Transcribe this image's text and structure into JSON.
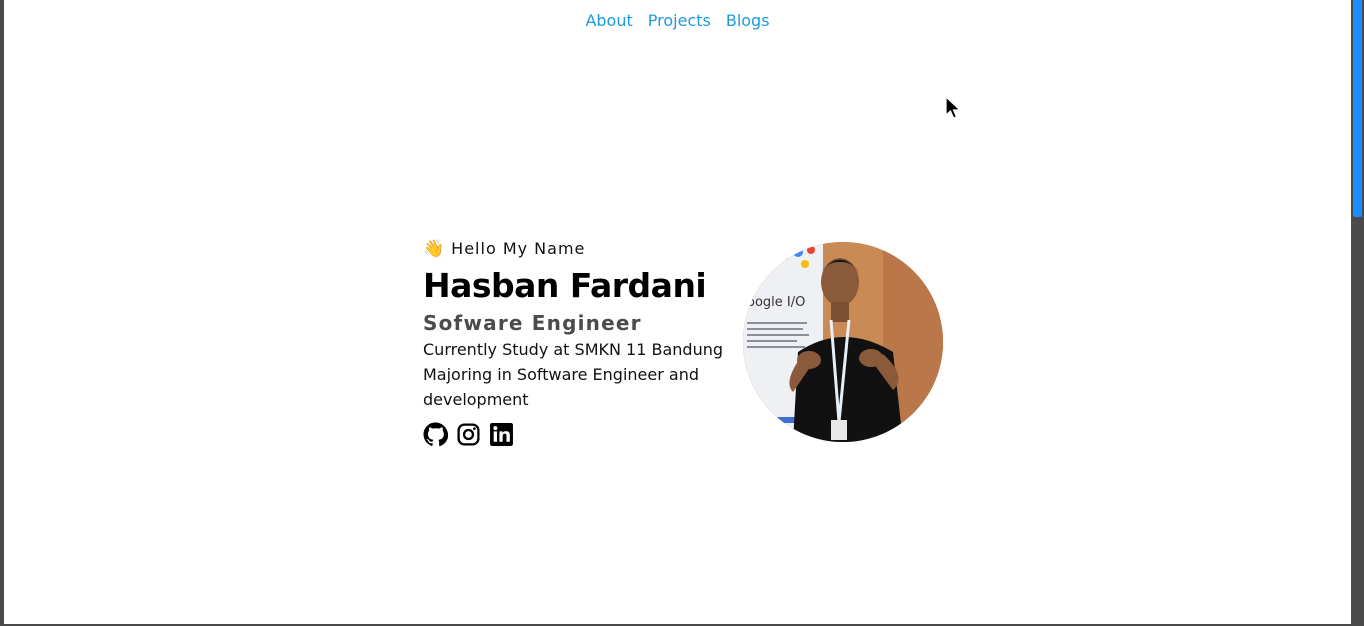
{
  "nav": {
    "items": [
      {
        "label": "About"
      },
      {
        "label": "Projects"
      },
      {
        "label": "Blogs"
      }
    ]
  },
  "hero": {
    "wave_emoji": "👋",
    "greeting": "Hello My Name",
    "name": "Hasban Fardani",
    "role": "Sofware Engineer",
    "bio": "Currently Study at SMKN 11 Bandung Majoring in Software Engineer and development"
  },
  "socials": [
    {
      "icon": "github-icon"
    },
    {
      "icon": "instagram-icon"
    },
    {
      "icon": "linkedin-icon"
    }
  ],
  "colors": {
    "nav_link": "#1e9ae0",
    "role": "#4b4b4b",
    "scrollbar_thumb": "#1a8cff"
  }
}
